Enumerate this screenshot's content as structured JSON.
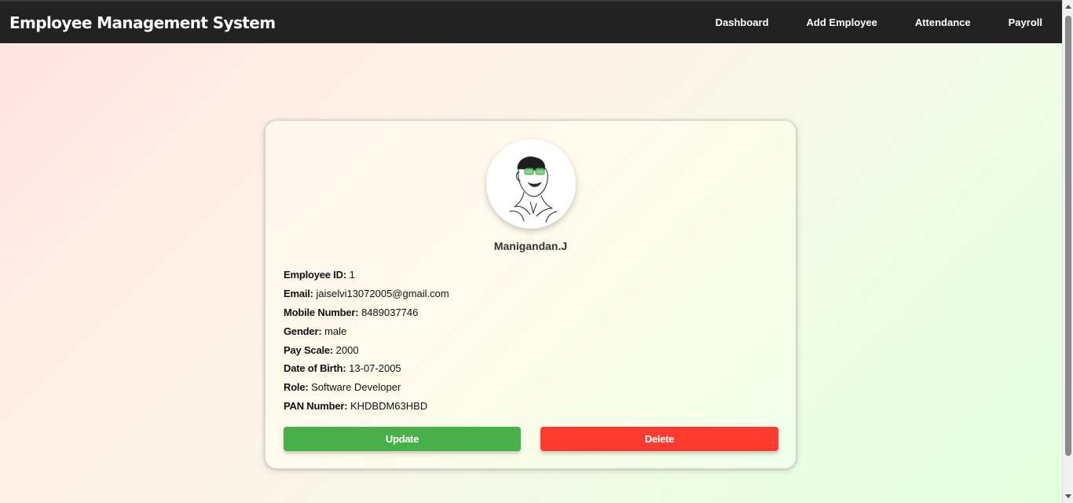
{
  "header": {
    "title": "Employee Management System",
    "nav": [
      "Dashboard",
      "Add Employee",
      "Attendance",
      "Payroll"
    ]
  },
  "profile": {
    "name": "Manigandan.J",
    "fields": [
      {
        "label": "Employee ID:",
        "value": "1"
      },
      {
        "label": "Email:",
        "value": "jaiselvi13072005@gmail.com"
      },
      {
        "label": "Mobile Number:",
        "value": "8489037746"
      },
      {
        "label": "Gender:",
        "value": "male"
      },
      {
        "label": "Pay Scale:",
        "value": "2000"
      },
      {
        "label": "Date of Birth:",
        "value": "13-07-2005"
      },
      {
        "label": "Role:",
        "value": "Software Developer"
      },
      {
        "label": "PAN Number:",
        "value": "KHDBDM63HBD"
      }
    ],
    "update_label": "Update",
    "delete_label": "Delete"
  },
  "colors": {
    "header_bg": "#222222",
    "update": "#47b04b",
    "delete": "#ff3b30"
  }
}
